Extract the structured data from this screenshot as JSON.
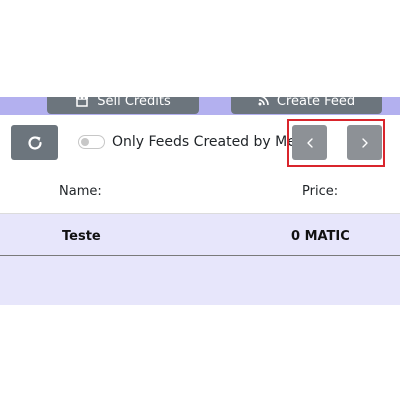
{
  "top_actions": {
    "sell_credits_label": "Sell Credits",
    "create_feed_label": "Create Feed"
  },
  "controls": {
    "only_mine_label": "Only Feeds Created by Me",
    "only_mine_checked": false
  },
  "table": {
    "headers": {
      "name": "Name:",
      "price": "Price:"
    },
    "rows": [
      {
        "name": "Teste",
        "price": "0 MATIC"
      }
    ]
  },
  "colors": {
    "accent_strip": "#b3b0ef",
    "button_gray": "#6c757d",
    "nav_button_gray": "#8d9196",
    "row_background": "#e7e6fb",
    "highlight_red": "#d9252c"
  }
}
